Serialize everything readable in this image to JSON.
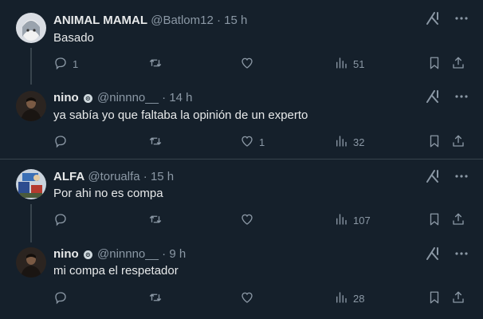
{
  "tweets": [
    {
      "display_name": "ANIMAL MAMAL",
      "handle": "@Batlom12",
      "sep": "·",
      "time": "15 h",
      "text": "Basado",
      "replies": "1",
      "retweets": "",
      "likes": "",
      "views": "51",
      "verified_badge": false
    },
    {
      "display_name": "nino",
      "handle": "@ninnno__",
      "sep": "·",
      "time": "14 h",
      "text": "ya sabía yo que faltaba la opinión de un experto",
      "replies": "",
      "retweets": "",
      "likes": "1",
      "views": "32",
      "verified_badge": true
    },
    {
      "display_name": "ALFA",
      "handle": "@torualfa",
      "sep": "·",
      "time": "15 h",
      "text": "Por ahi no es compa",
      "replies": "",
      "retweets": "",
      "likes": "",
      "views": "107",
      "verified_badge": false
    },
    {
      "display_name": "nino",
      "handle": "@ninnno__",
      "sep": "·",
      "time": "9 h",
      "text": "mi compa el respetador",
      "replies": "",
      "retweets": "",
      "likes": "",
      "views": "28",
      "verified_badge": true
    }
  ],
  "badge_glyph": "⊙",
  "colors": {
    "background": "#15202b",
    "text": "#e7e9ea",
    "muted": "#8b98a5",
    "divider": "#38444d"
  },
  "icons": {
    "reply": "reply-icon",
    "retweet": "retweet-icon",
    "like": "like-icon",
    "views": "views-icon",
    "bookmark": "bookmark-icon",
    "share": "share-icon",
    "grok": "grok-icon",
    "more": "more-icon"
  }
}
